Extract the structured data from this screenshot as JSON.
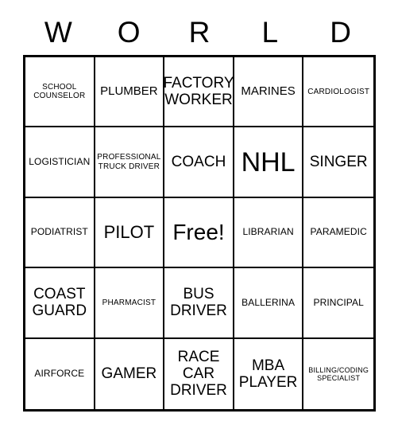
{
  "card": {
    "header_letters": [
      "W",
      "O",
      "R",
      "L",
      "D"
    ],
    "free_space_label": "Free!",
    "rows": [
      [
        {
          "label": "SCHOOL\nCOUNSELOR",
          "size": "s-sm"
        },
        {
          "label": "PLUMBER",
          "size": "s-lg"
        },
        {
          "label": "FACTORY\nWORKER",
          "size": "s-xl"
        },
        {
          "label": "MARINES",
          "size": "s-lg"
        },
        {
          "label": "CARDIOLOGIST",
          "size": "s-sm"
        }
      ],
      [
        {
          "label": "LOGISTICIAN",
          "size": "s-md"
        },
        {
          "label": "PROFESSIONAL\nTRUCK DRIVER",
          "size": "s-sm"
        },
        {
          "label": "COACH",
          "size": "s-xl"
        },
        {
          "label": "NHL",
          "size": "s-huge"
        },
        {
          "label": "SINGER",
          "size": "s-xl"
        }
      ],
      [
        {
          "label": "PODIATRIST",
          "size": "s-md"
        },
        {
          "label": "PILOT",
          "size": "s-xxl"
        },
        {
          "label": "Free!",
          "size": "s-free"
        },
        {
          "label": "LIBRARIAN",
          "size": "s-md"
        },
        {
          "label": "PARAMEDIC",
          "size": "s-md"
        }
      ],
      [
        {
          "label": "COAST\nGUARD",
          "size": "s-xl"
        },
        {
          "label": "PHARMACIST",
          "size": "s-sm"
        },
        {
          "label": "BUS\nDRIVER",
          "size": "s-xl"
        },
        {
          "label": "BALLERINA",
          "size": "s-md"
        },
        {
          "label": "PRINCIPAL",
          "size": "s-md"
        }
      ],
      [
        {
          "label": "AIRFORCE",
          "size": "s-md"
        },
        {
          "label": "GAMER",
          "size": "s-xl"
        },
        {
          "label": "RACE\nCAR\nDRIVER",
          "size": "s-xl"
        },
        {
          "label": "MBA\nPLAYER",
          "size": "s-xl"
        },
        {
          "label": "BILLING/CODING\nSPECIALIST",
          "size": "s-xs"
        }
      ]
    ]
  },
  "colors": {
    "background": "#ffffff",
    "ink": "#000000",
    "border": "#000000"
  }
}
